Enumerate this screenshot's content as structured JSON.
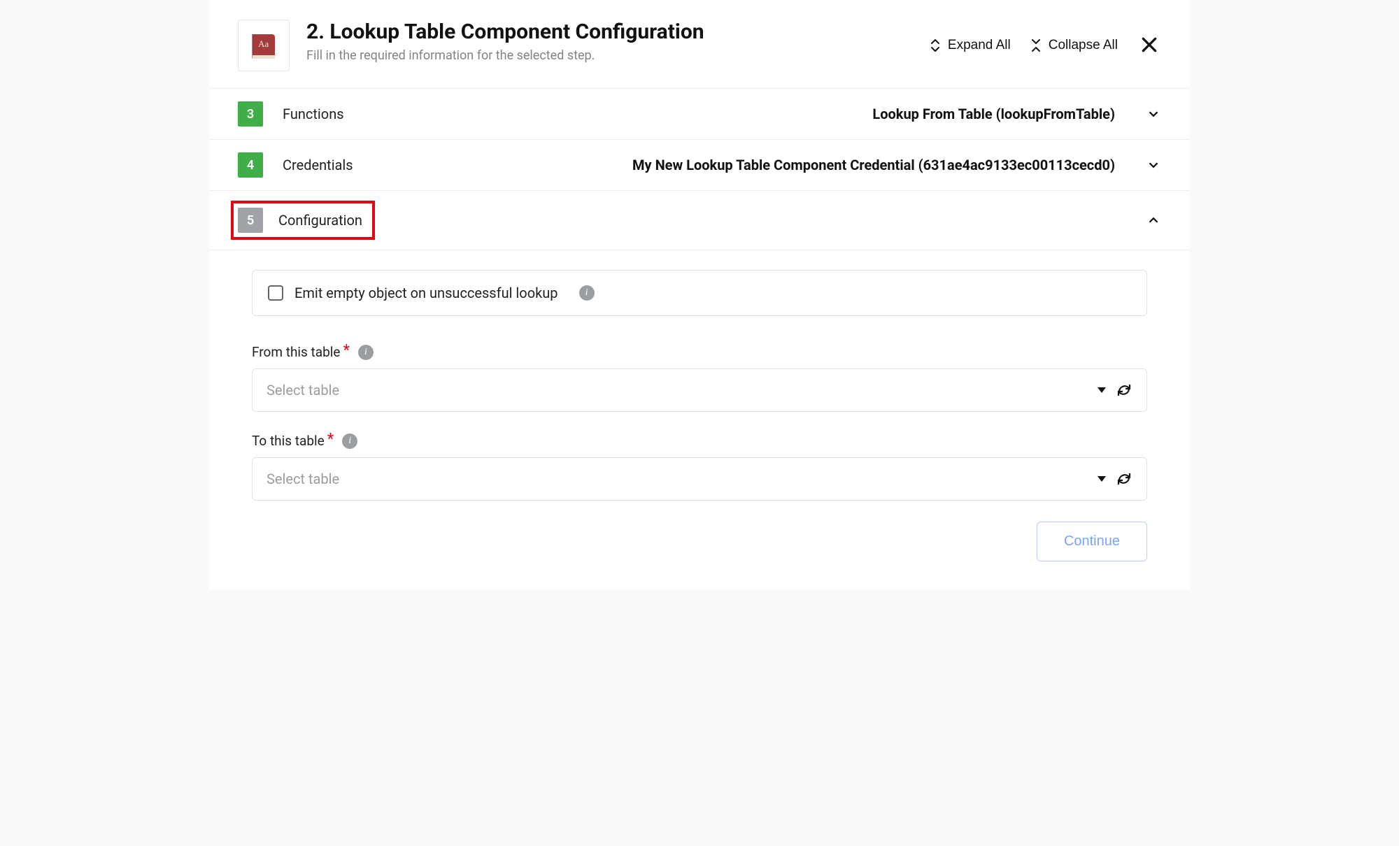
{
  "header": {
    "title": "2. Lookup Table Component Configuration",
    "subtitle": "Fill in the required information for the selected step.",
    "expand_label": "Expand All",
    "collapse_label": "Collapse All",
    "icon": "dictionary-book-icon"
  },
  "sections": {
    "functions": {
      "step": "3",
      "label": "Functions",
      "value": "Lookup From Table (lookupFromTable)"
    },
    "credentials": {
      "step": "4",
      "label": "Credentials",
      "value": "My New Lookup Table Component Credential (631ae4ac9133ec00113cecd0)"
    },
    "configuration": {
      "step": "5",
      "label": "Configuration"
    }
  },
  "config": {
    "emit_empty_label": "Emit empty object on unsuccessful lookup",
    "from_table_label": "From this table",
    "to_table_label": "To this table",
    "select_placeholder": "Select table",
    "continue_label": "Continue"
  }
}
